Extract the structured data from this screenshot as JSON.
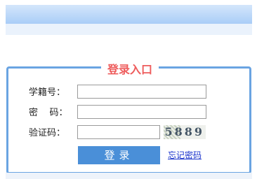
{
  "login": {
    "title": "登录入口",
    "student_id_label": "学籍号：",
    "password_label": "密    码：",
    "captcha_label": "验证码：",
    "student_id_value": "",
    "password_value": "",
    "captcha_value": "",
    "captcha_code": "5889",
    "submit_label": "登录",
    "forgot_label": "忘记密码"
  }
}
